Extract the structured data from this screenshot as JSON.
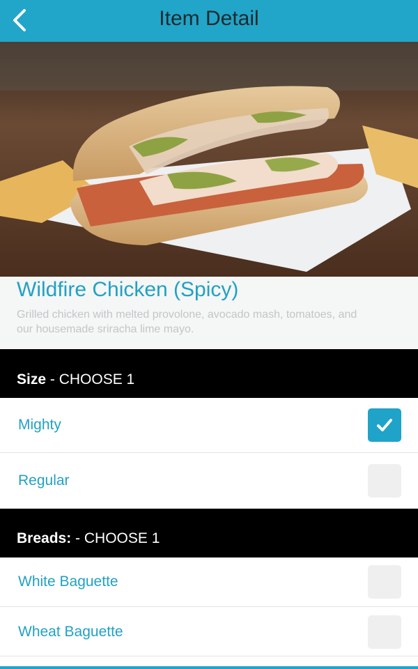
{
  "nav": {
    "title": "Item Detail",
    "back_icon": "chevron-left-icon"
  },
  "item": {
    "name": "Wildfire Chicken (Spicy)",
    "description": "Grilled chicken with melted provolone, avocado mash, tomatoes, and our housemade sriracha lime mayo."
  },
  "sections": [
    {
      "title": "Size",
      "suffix": " - CHOOSE 1",
      "options": [
        {
          "label": "Mighty",
          "checked": true
        },
        {
          "label": "Regular",
          "checked": false
        }
      ]
    },
    {
      "title": "Breads:",
      "suffix": " - CHOOSE 1",
      "options": [
        {
          "label": "White Baguette",
          "checked": false
        },
        {
          "label": "Wheat Baguette",
          "checked": false
        }
      ]
    }
  ],
  "colors": {
    "accent": "#21a5c9",
    "text_accent": "#21a1c4",
    "header_bg": "#000000"
  }
}
